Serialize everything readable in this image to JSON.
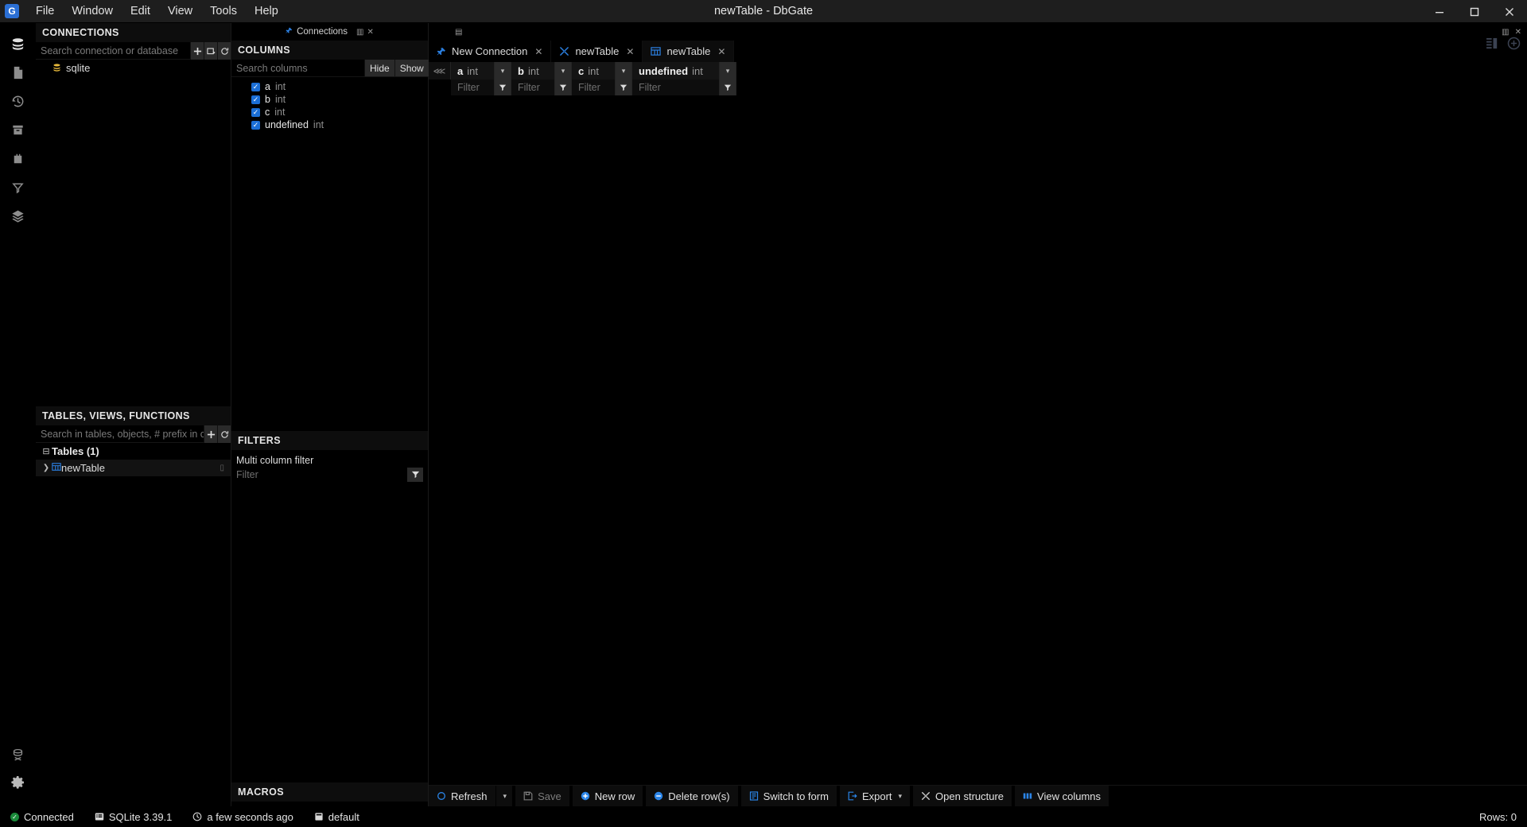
{
  "window": {
    "title": "newTable - DbGate",
    "logo_letter": "G",
    "controls": {
      "minimize": "minimize-icon",
      "maximize": "maximize-icon",
      "close": "close-icon"
    }
  },
  "menubar": [
    "File",
    "Window",
    "Edit",
    "View",
    "Tools",
    "Help"
  ],
  "rail": [
    {
      "name": "database-icon"
    },
    {
      "name": "file-icon"
    },
    {
      "name": "history-icon"
    },
    {
      "name": "archive-icon"
    },
    {
      "name": "plugins-icon"
    },
    {
      "name": "filter-icon"
    },
    {
      "name": "layers-icon"
    },
    {
      "name": "cloud-icon"
    },
    {
      "name": "settings-icon"
    }
  ],
  "connections_panel": {
    "title": "CONNECTIONS",
    "search_placeholder": "Search connection or database",
    "buttons": [
      "add-icon",
      "new-folder-icon",
      "refresh-icon"
    ],
    "items": [
      {
        "label": "sqlite",
        "icon": "database-icon"
      }
    ]
  },
  "tables_panel": {
    "title": "TABLES, VIEWS, FUNCTIONS",
    "search_placeholder": "Search in tables, objects, # prefix in colum",
    "buttons": [
      "add-icon",
      "refresh-icon"
    ],
    "group_label": "Tables (1)",
    "items": [
      {
        "label": "newTable",
        "icon": "table-icon"
      }
    ]
  },
  "middle_strip": {
    "tab_label": "Connections",
    "icon": "pin-icon"
  },
  "columns_panel": {
    "title": "COLUMNS",
    "search_placeholder": "Search columns",
    "hide_label": "Hide",
    "show_label": "Show",
    "columns": [
      {
        "name": "a",
        "type": "int",
        "checked": true
      },
      {
        "name": "b",
        "type": "int",
        "checked": true
      },
      {
        "name": "c",
        "type": "int",
        "checked": true
      },
      {
        "name": "undefined",
        "type": "int",
        "checked": true
      }
    ]
  },
  "filters_panel": {
    "title": "FILTERS",
    "label": "Multi column filter",
    "placeholder": "Filter",
    "button_icon": "filter-icon"
  },
  "macros_panel": {
    "title": "MACROS"
  },
  "document_tabs": [
    {
      "label": "New Connection",
      "icon": "plug-icon",
      "active": false
    },
    {
      "label": "newTable",
      "icon": "wrench-icon",
      "active": false
    },
    {
      "label": "newTable",
      "icon": "table-icon",
      "active": true
    }
  ],
  "grid": {
    "collapse_icon": "collapse-left-icon",
    "columns": [
      {
        "name": "a",
        "type": "int",
        "filter_placeholder": "Filter"
      },
      {
        "name": "b",
        "type": "int",
        "filter_placeholder": "Filter"
      },
      {
        "name": "c",
        "type": "int",
        "filter_placeholder": "Filter"
      },
      {
        "name": "undefined",
        "type": "int",
        "filter_placeholder": "Filter"
      }
    ],
    "rows": []
  },
  "toolbar": [
    {
      "label": "Refresh",
      "icon": "refresh-icon",
      "caret": true,
      "disabled": false
    },
    {
      "label": "Save",
      "icon": "save-icon",
      "caret": false,
      "disabled": true
    },
    {
      "label": "New row",
      "icon": "plus-circle-icon",
      "caret": false,
      "disabled": false
    },
    {
      "label": "Delete row(s)",
      "icon": "minus-circle-icon",
      "caret": false,
      "disabled": false
    },
    {
      "label": "Switch to form",
      "icon": "form-icon",
      "caret": false,
      "disabled": false
    },
    {
      "label": "Export",
      "icon": "export-icon",
      "caret": true,
      "disabled": false
    },
    {
      "label": "Open structure",
      "icon": "wrench-icon",
      "caret": false,
      "disabled": false
    },
    {
      "label": "View columns",
      "icon": "columns-icon",
      "caret": false,
      "disabled": false
    }
  ],
  "statusbar": {
    "connected": "Connected",
    "engine": "SQLite 3.39.1",
    "updated": "a few seconds ago",
    "database": "default",
    "rows": "Rows: 0"
  },
  "colors": {
    "accent": "#2b7fe0",
    "checkbox": "#1b6fd6",
    "connected": "#1a8a3a"
  }
}
